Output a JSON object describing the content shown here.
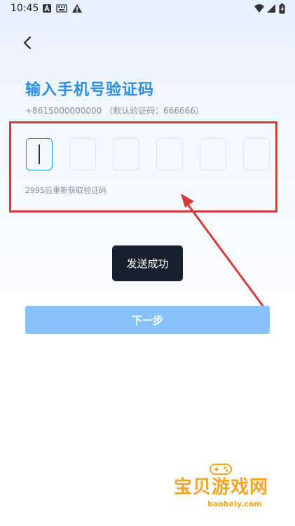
{
  "status_bar": {
    "time": "10:45",
    "icons": [
      "a-box-icon",
      "keyboard-icon",
      "warning-icon",
      "wifi-icon",
      "signal-icon",
      "battery-icon"
    ]
  },
  "header": {
    "title": "输入手机号验证码"
  },
  "phone_info": "+8615000000000 （默认验证码：666666）",
  "code_input": {
    "box_count": 6,
    "active_index": 0
  },
  "resend_text": "299S后重新获取验证码",
  "toast": "发送成功",
  "next_button": "下一步",
  "watermark": {
    "title": "宝贝游戏网",
    "url": "baobeiy.com"
  },
  "colors": {
    "accent": "#2a8ee9",
    "button": "#86c3fb",
    "annotation": "#d43a3a",
    "toast_bg": "#17212d"
  }
}
